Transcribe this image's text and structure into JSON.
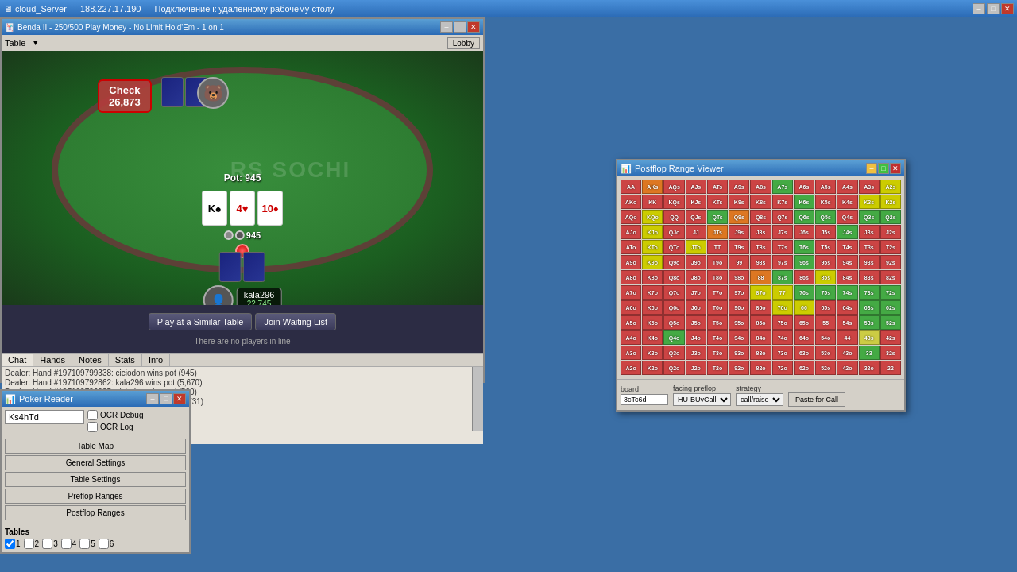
{
  "window": {
    "title": "cloud_Server — 188.227.17.190 — Подключение к удалённому рабочему столу",
    "minimize": "–",
    "maximize": "□",
    "close": "✕"
  },
  "poker_table": {
    "title": "Benda II - 250/500 Play Money - No Limit Hold'Em - 1 on 1",
    "lobby_label": "Lobby",
    "table_menu": "Table",
    "pot": "Pot: 945",
    "pot_value": "945",
    "action": "Check",
    "action_amount": "26,873",
    "player_top_name": "",
    "player_bottom_name": "kala296",
    "player_bottom_stack": "22,745",
    "watermark": "RS SOCHI",
    "community_cards": [
      {
        "rank": "K",
        "suit": "♠",
        "color": "black"
      },
      {
        "rank": "4",
        "suit": "♥",
        "color": "red"
      },
      {
        "rank": "10",
        "suit": "♦",
        "color": "red"
      }
    ]
  },
  "waiting": {
    "play_similar": "Play at a Similar Table",
    "join_waiting": "Join Waiting List",
    "status": "There are no players in line"
  },
  "chat": {
    "tab_chat": "Chat",
    "tab_hands": "Hands",
    "tab_notes": "Notes",
    "tab_stats": "Stats",
    "tab_info": "Info",
    "messages": [
      "Dealer: Hand #197109799338: ciciodon wins pot (945)",
      "Dealer: Hand #197109792862: kala296 wins pot (5,670)",
      "Dealer: Hand #197109796035: ciciodon wins pot (500)",
      "Dealer: Hand #197109798053: ciciodon wins pot (2,731)"
    ]
  },
  "range_viewer": {
    "title": "Postflop Range Viewer",
    "board_label": "board",
    "board_value": "3cTc6d",
    "facing_label": "facing preflop",
    "facing_value": "HU-BUvCall",
    "strategy_label": "strategy",
    "strategy_value": "call/raise",
    "paste_btn": "Paste for Call",
    "minimize": "–",
    "maximize": "□",
    "close": "✕",
    "rows": [
      {
        "cells": [
          {
            "label": "AA",
            "color": "#cc4444"
          },
          {
            "label": "AKs",
            "color": "#dd7722"
          },
          {
            "label": "AQs",
            "color": "#cc4444"
          },
          {
            "label": "AJs",
            "color": "#cc4444"
          },
          {
            "label": "ATs",
            "color": "#cc4444"
          },
          {
            "label": "A9s",
            "color": "#cc4444"
          },
          {
            "label": "A8s",
            "color": "#cc4444"
          },
          {
            "label": "A7s",
            "color": "#44aa44"
          },
          {
            "label": "A6s",
            "color": "#cc4444"
          },
          {
            "label": "A5s",
            "color": "#cc4444"
          },
          {
            "label": "A4s",
            "color": "#cc4444"
          },
          {
            "label": "A3s",
            "color": "#cc4444"
          },
          {
            "label": "A2s",
            "color": "#cccc00"
          }
        ]
      },
      {
        "cells": [
          {
            "label": "AKo",
            "color": "#cc4444"
          },
          {
            "label": "KK",
            "color": "#cc4444"
          },
          {
            "label": "KQs",
            "color": "#cc4444"
          },
          {
            "label": "KJs",
            "color": "#cc4444"
          },
          {
            "label": "KTs",
            "color": "#cc4444"
          },
          {
            "label": "K9s",
            "color": "#cc4444"
          },
          {
            "label": "K8s",
            "color": "#cc4444"
          },
          {
            "label": "K7s",
            "color": "#cc4444"
          },
          {
            "label": "K6s",
            "color": "#44aa44"
          },
          {
            "label": "K5s",
            "color": "#cc4444"
          },
          {
            "label": "K4s",
            "color": "#cc4444"
          },
          {
            "label": "K3s",
            "color": "#cccc00"
          },
          {
            "label": "K2s",
            "color": "#cccc00"
          }
        ]
      },
      {
        "cells": [
          {
            "label": "AQo",
            "color": "#cc4444"
          },
          {
            "label": "KQo",
            "color": "#cccc00"
          },
          {
            "label": "QQ",
            "color": "#cc4444"
          },
          {
            "label": "QJs",
            "color": "#cc4444"
          },
          {
            "label": "QTs",
            "color": "#44aa44"
          },
          {
            "label": "Q9s",
            "color": "#dd7722"
          },
          {
            "label": "Q8s",
            "color": "#cc4444"
          },
          {
            "label": "Q7s",
            "color": "#cc4444"
          },
          {
            "label": "Q6s",
            "color": "#44aa44"
          },
          {
            "label": "Q5s",
            "color": "#44aa44"
          },
          {
            "label": "Q4s",
            "color": "#cc4444"
          },
          {
            "label": "Q3s",
            "color": "#44aa44"
          },
          {
            "label": "Q2s",
            "color": "#44aa44"
          }
        ]
      },
      {
        "cells": [
          {
            "label": "AJo",
            "color": "#cc4444"
          },
          {
            "label": "KJo",
            "color": "#cccc00"
          },
          {
            "label": "QJo",
            "color": "#cc4444"
          },
          {
            "label": "JJ",
            "color": "#cc4444"
          },
          {
            "label": "JTs",
            "color": "#dd7722"
          },
          {
            "label": "J9s",
            "color": "#cc4444"
          },
          {
            "label": "J8s",
            "color": "#cc4444"
          },
          {
            "label": "J7s",
            "color": "#cc4444"
          },
          {
            "label": "J6s",
            "color": "#cc4444"
          },
          {
            "label": "J5s",
            "color": "#cc4444"
          },
          {
            "label": "J4s",
            "color": "#44aa44"
          },
          {
            "label": "J3s",
            "color": "#cc4444"
          },
          {
            "label": "J2s",
            "color": "#cc4444"
          }
        ]
      },
      {
        "cells": [
          {
            "label": "ATo",
            "color": "#cc4444"
          },
          {
            "label": "KTo",
            "color": "#cccc00"
          },
          {
            "label": "QTo",
            "color": "#cc4444"
          },
          {
            "label": "JTo",
            "color": "#cccc00"
          },
          {
            "label": "TT",
            "color": "#cc4444"
          },
          {
            "label": "T9s",
            "color": "#cc4444"
          },
          {
            "label": "T8s",
            "color": "#cc4444"
          },
          {
            "label": "T7s",
            "color": "#cc4444"
          },
          {
            "label": "T6s",
            "color": "#44aa44"
          },
          {
            "label": "T5s",
            "color": "#cc4444"
          },
          {
            "label": "T4s",
            "color": "#cc4444"
          },
          {
            "label": "T3s",
            "color": "#cc4444"
          },
          {
            "label": "T2s",
            "color": "#cc4444"
          }
        ]
      },
      {
        "cells": [
          {
            "label": "A9o",
            "color": "#cc4444"
          },
          {
            "label": "K9o",
            "color": "#cccc00"
          },
          {
            "label": "Q9o",
            "color": "#cc4444"
          },
          {
            "label": "J9o",
            "color": "#cc4444"
          },
          {
            "label": "T9o",
            "color": "#cc4444"
          },
          {
            "label": "99",
            "color": "#cc4444"
          },
          {
            "label": "98s",
            "color": "#cc4444"
          },
          {
            "label": "97s",
            "color": "#cc4444"
          },
          {
            "label": "96s",
            "color": "#44aa44"
          },
          {
            "label": "95s",
            "color": "#cc4444"
          },
          {
            "label": "94s",
            "color": "#cc4444"
          },
          {
            "label": "93s",
            "color": "#cc4444"
          },
          {
            "label": "92s",
            "color": "#cc4444"
          }
        ]
      },
      {
        "cells": [
          {
            "label": "A8o",
            "color": "#cc4444"
          },
          {
            "label": "K8o",
            "color": "#cc4444"
          },
          {
            "label": "Q8o",
            "color": "#cc4444"
          },
          {
            "label": "J8o",
            "color": "#cc4444"
          },
          {
            "label": "T8o",
            "color": "#cc4444"
          },
          {
            "label": "98o",
            "color": "#cc4444"
          },
          {
            "label": "88",
            "color": "#dd7722"
          },
          {
            "label": "87s",
            "color": "#44aa44"
          },
          {
            "label": "86s",
            "color": "#cc4444"
          },
          {
            "label": "85s",
            "color": "#cccc00"
          },
          {
            "label": "84s",
            "color": "#cc4444"
          },
          {
            "label": "83s",
            "color": "#cc4444"
          },
          {
            "label": "82s",
            "color": "#cc4444"
          }
        ]
      },
      {
        "cells": [
          {
            "label": "A7o",
            "color": "#cc4444"
          },
          {
            "label": "K7o",
            "color": "#cc4444"
          },
          {
            "label": "Q7o",
            "color": "#cc4444"
          },
          {
            "label": "J7o",
            "color": "#cc4444"
          },
          {
            "label": "T7o",
            "color": "#cc4444"
          },
          {
            "label": "97o",
            "color": "#cc4444"
          },
          {
            "label": "87o",
            "color": "#cccc00"
          },
          {
            "label": "77",
            "color": "#cccc00"
          },
          {
            "label": "76s",
            "color": "#44aa44"
          },
          {
            "label": "75s",
            "color": "#44aa44"
          },
          {
            "label": "74s",
            "color": "#44aa44"
          },
          {
            "label": "73s",
            "color": "#44aa44"
          },
          {
            "label": "72s",
            "color": "#44aa44"
          }
        ]
      },
      {
        "cells": [
          {
            "label": "A6o",
            "color": "#cc4444"
          },
          {
            "label": "K6o",
            "color": "#cc4444"
          },
          {
            "label": "Q6o",
            "color": "#cc4444"
          },
          {
            "label": "J6o",
            "color": "#cc4444"
          },
          {
            "label": "T6o",
            "color": "#cc4444"
          },
          {
            "label": "96o",
            "color": "#cc4444"
          },
          {
            "label": "86o",
            "color": "#cc4444"
          },
          {
            "label": "76o",
            "color": "#cccc00"
          },
          {
            "label": "66",
            "color": "#cccc00"
          },
          {
            "label": "65s",
            "color": "#cc4444"
          },
          {
            "label": "64s",
            "color": "#cc4444"
          },
          {
            "label": "63s",
            "color": "#44aa44"
          },
          {
            "label": "62s",
            "color": "#44aa44"
          }
        ]
      },
      {
        "cells": [
          {
            "label": "A5o",
            "color": "#cc4444"
          },
          {
            "label": "K5o",
            "color": "#cc4444"
          },
          {
            "label": "Q5o",
            "color": "#cc4444"
          },
          {
            "label": "J5o",
            "color": "#cc4444"
          },
          {
            "label": "T5o",
            "color": "#cc4444"
          },
          {
            "label": "95o",
            "color": "#cc4444"
          },
          {
            "label": "85o",
            "color": "#cc4444"
          },
          {
            "label": "75o",
            "color": "#cc4444"
          },
          {
            "label": "65o",
            "color": "#cc4444"
          },
          {
            "label": "55",
            "color": "#cc4444"
          },
          {
            "label": "54s",
            "color": "#cc4444"
          },
          {
            "label": "53s",
            "color": "#44aa44"
          },
          {
            "label": "52s",
            "color": "#44aa44"
          }
        ]
      },
      {
        "cells": [
          {
            "label": "A4o",
            "color": "#cc4444"
          },
          {
            "label": "K4o",
            "color": "#cc4444"
          },
          {
            "label": "Q4o",
            "color": "#44aa44"
          },
          {
            "label": "J4o",
            "color": "#cc4444"
          },
          {
            "label": "T4o",
            "color": "#cc4444"
          },
          {
            "label": "94o",
            "color": "#cc4444"
          },
          {
            "label": "84o",
            "color": "#cc4444"
          },
          {
            "label": "74o",
            "color": "#cc4444"
          },
          {
            "label": "64o",
            "color": "#cc4444"
          },
          {
            "label": "54o",
            "color": "#cc4444"
          },
          {
            "label": "44",
            "color": "#cc4444"
          },
          {
            "label": "43s",
            "color": "#cccc44"
          },
          {
            "label": "42s",
            "color": "#cc4444"
          }
        ]
      },
      {
        "cells": [
          {
            "label": "A3o",
            "color": "#cc4444"
          },
          {
            "label": "K3o",
            "color": "#cc4444"
          },
          {
            "label": "Q3o",
            "color": "#cc4444"
          },
          {
            "label": "J3o",
            "color": "#cc4444"
          },
          {
            "label": "T3o",
            "color": "#cc4444"
          },
          {
            "label": "93o",
            "color": "#cc4444"
          },
          {
            "label": "83o",
            "color": "#cc4444"
          },
          {
            "label": "73o",
            "color": "#cc4444"
          },
          {
            "label": "63o",
            "color": "#cc4444"
          },
          {
            "label": "53o",
            "color": "#cc4444"
          },
          {
            "label": "43o",
            "color": "#cc4444"
          },
          {
            "label": "33",
            "color": "#44aa44"
          },
          {
            "label": "32s",
            "color": "#cc4444"
          }
        ]
      },
      {
        "cells": [
          {
            "label": "A2o",
            "color": "#cc4444"
          },
          {
            "label": "K2o",
            "color": "#cc4444"
          },
          {
            "label": "Q2o",
            "color": "#cc4444"
          },
          {
            "label": "J2o",
            "color": "#cc4444"
          },
          {
            "label": "T2o",
            "color": "#cc4444"
          },
          {
            "label": "92o",
            "color": "#cc4444"
          },
          {
            "label": "82o",
            "color": "#cc4444"
          },
          {
            "label": "72o",
            "color": "#cc4444"
          },
          {
            "label": "62o",
            "color": "#cc4444"
          },
          {
            "label": "52o",
            "color": "#cc4444"
          },
          {
            "label": "42o",
            "color": "#cc4444"
          },
          {
            "label": "32o",
            "color": "#cc4444"
          },
          {
            "label": "22",
            "color": "#cc4444"
          }
        ]
      }
    ]
  },
  "poker_reader": {
    "title": "Poker Reader",
    "minimize": "–",
    "maximize": "□",
    "close": "✕",
    "hand": "Ks4hTd",
    "ocr_debug": "OCR Debug",
    "ocr_log": "OCR Log",
    "table_map": "Table Map",
    "general_settings": "General Settings",
    "table_settings": "Table Settings",
    "preflop_ranges": "Preflop Ranges",
    "postflop_ranges": "Postflop Ranges",
    "tables_label": "Tables",
    "table_nums": [
      "1",
      "2",
      "3",
      "4",
      "5",
      "6"
    ],
    "table_checks": [
      true,
      false,
      false,
      false,
      false,
      false
    ]
  }
}
